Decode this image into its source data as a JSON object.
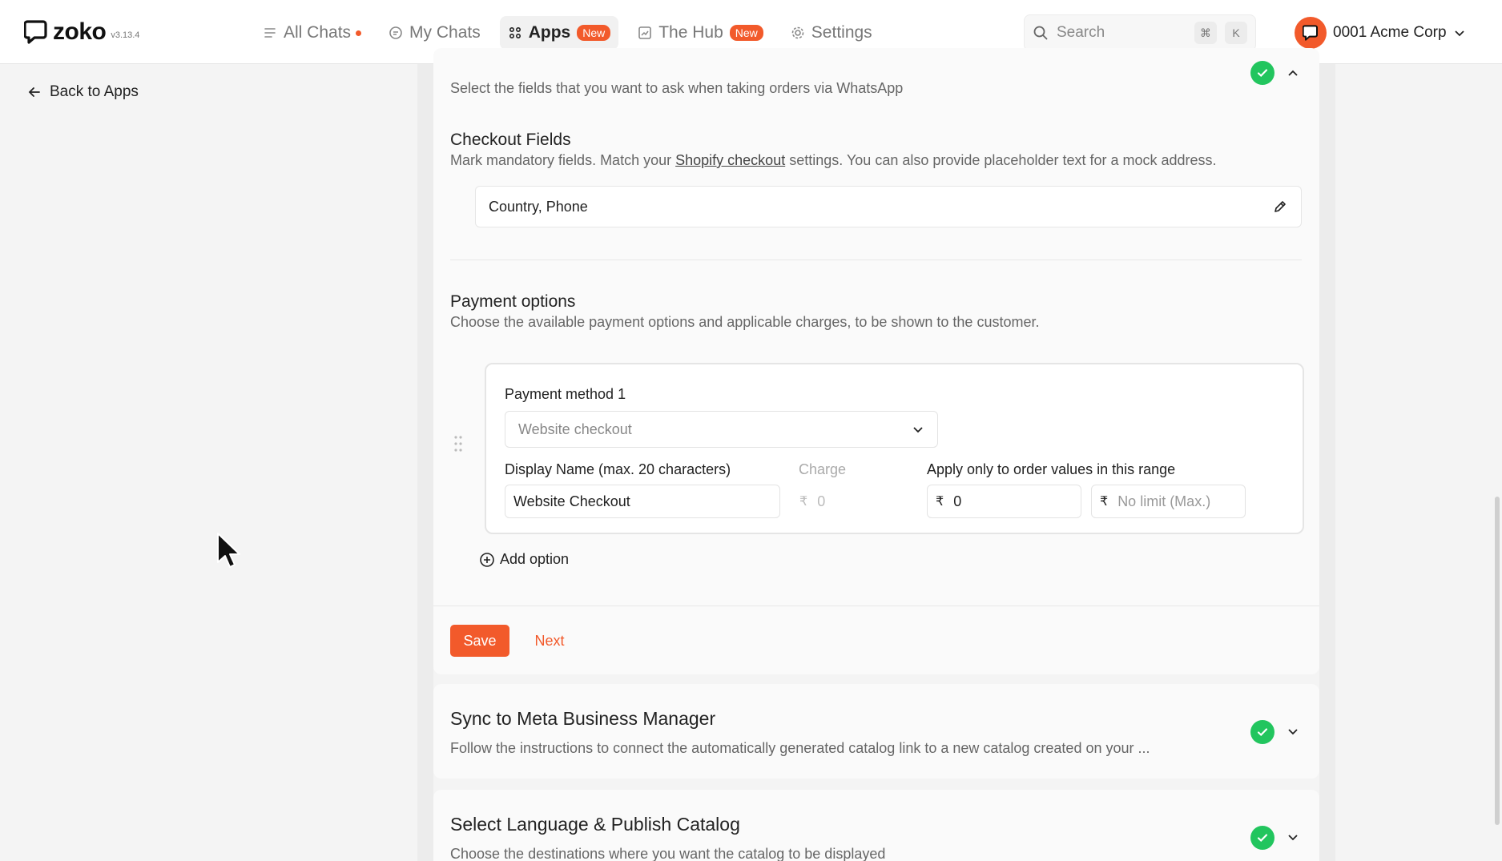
{
  "app": {
    "logo_text": "zoko",
    "version": "v3.13.4"
  },
  "nav": {
    "items": [
      {
        "label": "All Chats",
        "icon": "list-icon",
        "dot": true
      },
      {
        "label": "My Chats",
        "icon": "chat-bubble-icon"
      },
      {
        "label": "Apps",
        "icon": "apps-grid-icon",
        "badge": "New",
        "active": true
      },
      {
        "label": "The Hub",
        "icon": "chart-icon",
        "badge": "New"
      },
      {
        "label": "Settings",
        "icon": "gear-icon"
      }
    ]
  },
  "search": {
    "placeholder": "Search",
    "shortcut_1": "⌘",
    "shortcut_2": "K"
  },
  "account": {
    "name": "0001 Acme Corp"
  },
  "sidebar": {
    "back_label": "Back to Apps"
  },
  "checkout_card": {
    "subtitle": "Select the fields that you want to ask when taking orders via WhatsApp",
    "checkout_fields": {
      "title": "Checkout Fields",
      "desc_before": "Mark mandatory fields. Match your",
      "desc_link": "Shopify checkout",
      "desc_after": "settings. You can also provide placeholder text for a mock address.",
      "value": "Country, Phone"
    },
    "payment_options": {
      "title": "Payment options",
      "desc": "Choose the available payment options and applicable charges, to be shown to the customer.",
      "method": {
        "label": "Payment method 1",
        "selected": "Website checkout",
        "display_name_label": "Display Name (max. 20 characters)",
        "display_name_value": "Website Checkout",
        "charge_label": "Charge",
        "charge_currency": "₹",
        "charge_value": "0",
        "range_label": "Apply only to order values in this range",
        "range_min_currency": "₹",
        "range_min": "0",
        "range_max_currency": "₹",
        "range_max_placeholder": "No limit (Max.)"
      },
      "add_option_label": "Add option"
    },
    "save_label": "Save",
    "next_label": "Next"
  },
  "sync_card": {
    "title": "Sync to Meta Business Manager",
    "subtitle": "Follow the instructions to connect the automatically generated catalog link to a new catalog created on your ..."
  },
  "publish_card": {
    "title": "Select Language & Publish Catalog",
    "subtitle": "Choose the destinations where you want the catalog to be displayed"
  },
  "colors": {
    "accent": "#f25a2b",
    "success": "#22c55e"
  }
}
